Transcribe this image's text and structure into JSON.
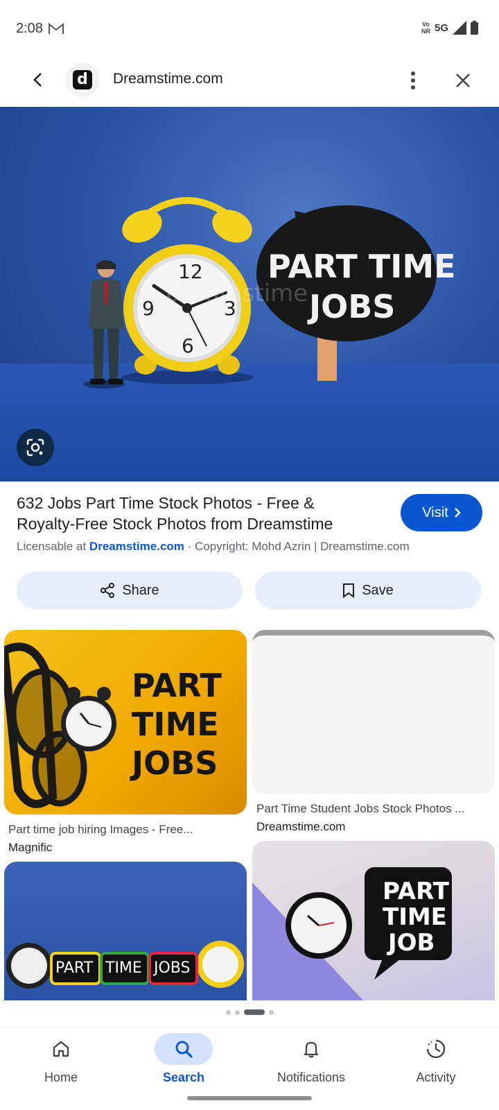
{
  "status_bar": {
    "time": "2:08",
    "network_label_top": "Vo​",
    "network_label_bottom": "NR",
    "network_type": "5G",
    "icons": [
      "gmail-icon",
      "signal-icon",
      "battery-icon"
    ]
  },
  "header": {
    "site_name": "Dreamstime.com",
    "favicon_letter": "d",
    "icons": [
      "back-arrow-icon",
      "more-vert-icon",
      "close-icon"
    ]
  },
  "hero": {
    "sign_line1": "PART TIME",
    "sign_line2": "JOBS",
    "clock_12": "12",
    "clock_9": "9",
    "clock_3": "3",
    "clock_6": "6",
    "watermark": "dreamstime",
    "lens_icon": "google-lens-icon"
  },
  "result": {
    "title": "632 Jobs Part Time Stock Photos - Free & Royalty-Free Stock Photos from Dreamstime",
    "visit_label": "Visit",
    "license_prefix": "Licensable at",
    "license_link": "Dreamstime.com",
    "copyright": " · Copyright: Mohd Azrin | Dreamstime.com",
    "share_label": "Share",
    "save_label": "Save"
  },
  "related": [
    {
      "caption": "Part time job hiring Images - Free...",
      "source": "Magnific",
      "image_text": [
        "PART",
        "TIME",
        "JOBS"
      ]
    },
    {
      "caption": "Part Time Student Jobs Stock Photos ...",
      "source": "Dreamstime.com"
    },
    {
      "image_text": [
        "PART",
        "TIME",
        "JOBS"
      ]
    },
    {
      "image_text": [
        "PART",
        "TIME",
        "JOB"
      ]
    }
  ],
  "pager": {
    "dots": 4,
    "active_index": 2
  },
  "bottom_nav": {
    "items": [
      {
        "label": "Home",
        "icon": "home-icon"
      },
      {
        "label": "Search",
        "icon": "search-icon",
        "active": true
      },
      {
        "label": "Notifications",
        "icon": "bell-icon"
      },
      {
        "label": "Activity",
        "icon": "activity-icon"
      }
    ]
  },
  "colors": {
    "accent": "#0b57d0",
    "chip_bg": "#e8eef9",
    "nav_active_bg": "#d3e3fd"
  }
}
